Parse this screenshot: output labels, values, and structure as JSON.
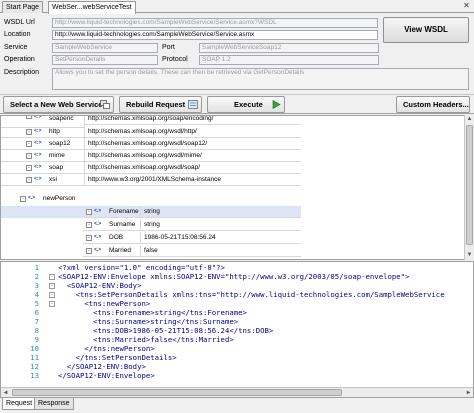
{
  "tabs": [
    {
      "label": "Start Page",
      "active": false
    },
    {
      "label": "WebSer...webServiceTest",
      "active": true
    }
  ],
  "form": {
    "wsdl_url_label": "WSDL Url",
    "wsdl_url_value": "http://www.liquid-technologies.com/SampleWebService/Service.asmx?WSDL",
    "location_label": "Location",
    "location_value": "http://www.liquid-technologies.com/SampleWebService/Service.asmx",
    "service_label": "Service",
    "service_value": "SampleWebService",
    "port_label": "Port",
    "port_value": "SampleWebServiceSoap12",
    "operation_label": "Operation",
    "operation_value": "SetPersonDetails",
    "protocol_label": "Protocol",
    "protocol_value": "SOAP 1.2",
    "description_label": "Description",
    "description_value": "Allows you to set the person details. These can then be retrieved via GetPersonDetails"
  },
  "view_wsdl_label": "View WSDL",
  "toolbar": {
    "select_label": "Select a New Web Service",
    "rebuild_label": "Rebuild Request",
    "execute_label": "Execute",
    "custom_headers_label": "Custom Headers..."
  },
  "tree": {
    "namespaces": [
      {
        "prefix": "soapenc",
        "uri": "http://schemas.xmlsoap.org/soap/encoding/"
      },
      {
        "prefix": "http",
        "uri": "http://schemas.xmlsoap.org/wsdl/http/"
      },
      {
        "prefix": "soap12",
        "uri": "http://schemas.xmlsoap.org/wsdl/soap12/"
      },
      {
        "prefix": "mime",
        "uri": "http://schemas.xmlsoap.org/wsdl/mime/"
      },
      {
        "prefix": "soap",
        "uri": "http://schemas.xmlsoap.org/wsdl/soap/"
      },
      {
        "prefix": "xsi",
        "uri": "http://www.w3.org/2001/XMLSchema-instance"
      }
    ],
    "element_name": "newPerson",
    "fields": [
      {
        "name": "Forename",
        "value": "string"
      },
      {
        "name": "Surname",
        "value": "string"
      },
      {
        "name": "DOB",
        "value": "1986-05-21T15:08:56.24"
      },
      {
        "name": "Married",
        "value": "false"
      }
    ]
  },
  "code_lines": [
    {
      "n": "1",
      "text": "<?xml version=\"1.0\" encoding=\"utf-8\"?>",
      "fold": ""
    },
    {
      "n": "2",
      "text": "<SOAP12-ENV:Envelope xmlns:SOAP12-ENV=\"http://www.w3.org/2003/05/soap-envelope\">",
      "fold": "-"
    },
    {
      "n": "3",
      "text": "  <SOAP12-ENV:Body>",
      "fold": "-"
    },
    {
      "n": "4",
      "text": "    <tns:SetPersonDetails xmlns:tns=\"http://www.liquid-technologies.com/SampleWebService",
      "fold": "-"
    },
    {
      "n": "5",
      "text": "      <tns:newPerson>",
      "fold": "-"
    },
    {
      "n": "6",
      "text": "        <tns:Forename>string</tns:Forename>",
      "fold": ""
    },
    {
      "n": "7",
      "text": "        <tns:Surname>string</tns:Surname>",
      "fold": ""
    },
    {
      "n": "8",
      "text": "        <tns:DOB>1986-05-21T15:08:56.24</tns:DOB>",
      "fold": ""
    },
    {
      "n": "9",
      "text": "        <tns:Married>false</tns:Married>",
      "fold": ""
    },
    {
      "n": "10",
      "text": "      </tns:newPerson>",
      "fold": ""
    },
    {
      "n": "11",
      "text": "    </tns:SetPersonDetails>",
      "fold": ""
    },
    {
      "n": "12",
      "text": "  </SOAP12-ENV:Body>",
      "fold": ""
    },
    {
      "n": "13",
      "text": "</SOAP12-ENV:Envelope>",
      "fold": ""
    }
  ],
  "bottom_tabs": [
    {
      "label": "Request",
      "active": true
    },
    {
      "label": "Response",
      "active": false
    }
  ],
  "colors": {
    "selected_row": "#dde4f5",
    "line_numbers": "#2b91af",
    "xml_tag": "#00008b"
  }
}
